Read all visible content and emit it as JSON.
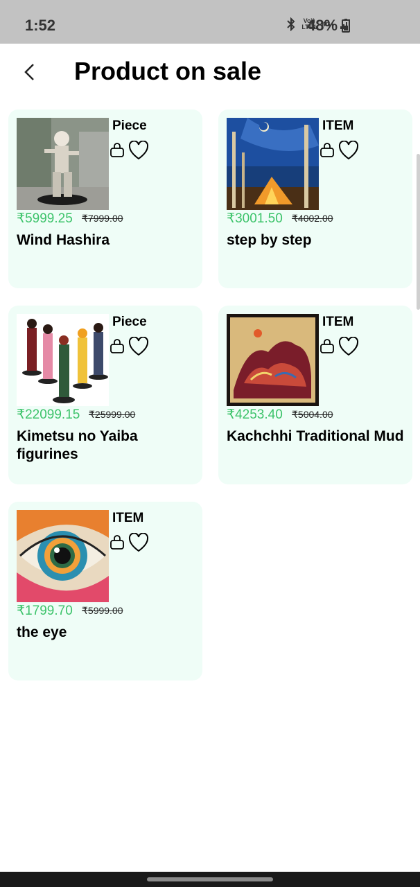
{
  "status": {
    "time": "1:52",
    "network_top": "Vo))",
    "network_bottom": "LTE1",
    "gen": "4G+",
    "battery": "48%"
  },
  "header": {
    "title": "Product on sale"
  },
  "products": [
    {
      "name": "Wind Hashira",
      "unit": "Piece",
      "price": "₹5999.25",
      "old_price": "₹7999.00"
    },
    {
      "name": "step by step",
      "unit": "ITEM",
      "price": "₹3001.50",
      "old_price": "₹4002.00"
    },
    {
      "name": "Kimetsu no Yaiba figurines",
      "unit": "Piece",
      "price": "₹22099.15",
      "old_price": "₹25999.00"
    },
    {
      "name": "Kachchhi Traditional Mud",
      "unit": "ITEM",
      "price": "₹4253.40",
      "old_price": "₹5004.00"
    },
    {
      "name": "the eye",
      "unit": "ITEM",
      "price": "₹1799.70",
      "old_price": "₹5999.00"
    }
  ],
  "colors": {
    "card_bg": "#effdf7",
    "price_green": "#3cc36a",
    "status_bar": "#c2c2c2"
  }
}
